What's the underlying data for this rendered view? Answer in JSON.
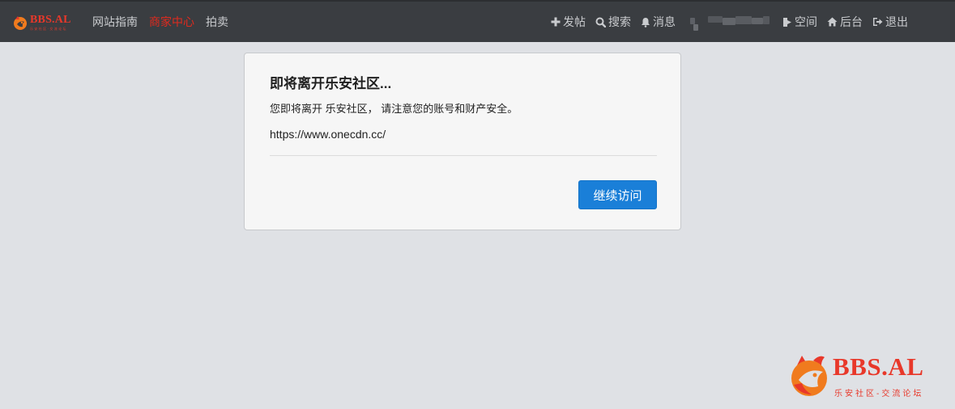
{
  "navbar": {
    "brand": {
      "name": "BBS.AL",
      "tagline": "乐安社区·交流论坛"
    },
    "left_links": [
      {
        "label": "网站指南",
        "active": false
      },
      {
        "label": "商家中心",
        "active": true
      },
      {
        "label": "拍卖",
        "active": false
      }
    ],
    "right_items": [
      {
        "icon": "plus-icon",
        "label": "发帖"
      },
      {
        "icon": "search-icon",
        "label": "搜索"
      },
      {
        "icon": "bell-icon",
        "label": "消息"
      }
    ],
    "right_items_after_user": [
      {
        "icon": "share-icon",
        "label": "空间"
      },
      {
        "icon": "home-icon",
        "label": "后台"
      },
      {
        "icon": "logout-icon",
        "label": "退出"
      }
    ],
    "colors": {
      "bar": "#3a3d41",
      "text": "#c9cbce",
      "active": "#e02a1e"
    }
  },
  "dialog": {
    "title": "即将离开乐安社区...",
    "message": "您即将离开 乐安社区， 请注意您的账号和财产安全。",
    "url": "https://www.onecdn.cc/",
    "continue_label": "继续访问",
    "colors": {
      "button": "#1a7fd8"
    }
  },
  "watermark": {
    "name": "BBS.AL",
    "tagline": "乐安社区-交流论坛",
    "color": "#e8382a"
  }
}
